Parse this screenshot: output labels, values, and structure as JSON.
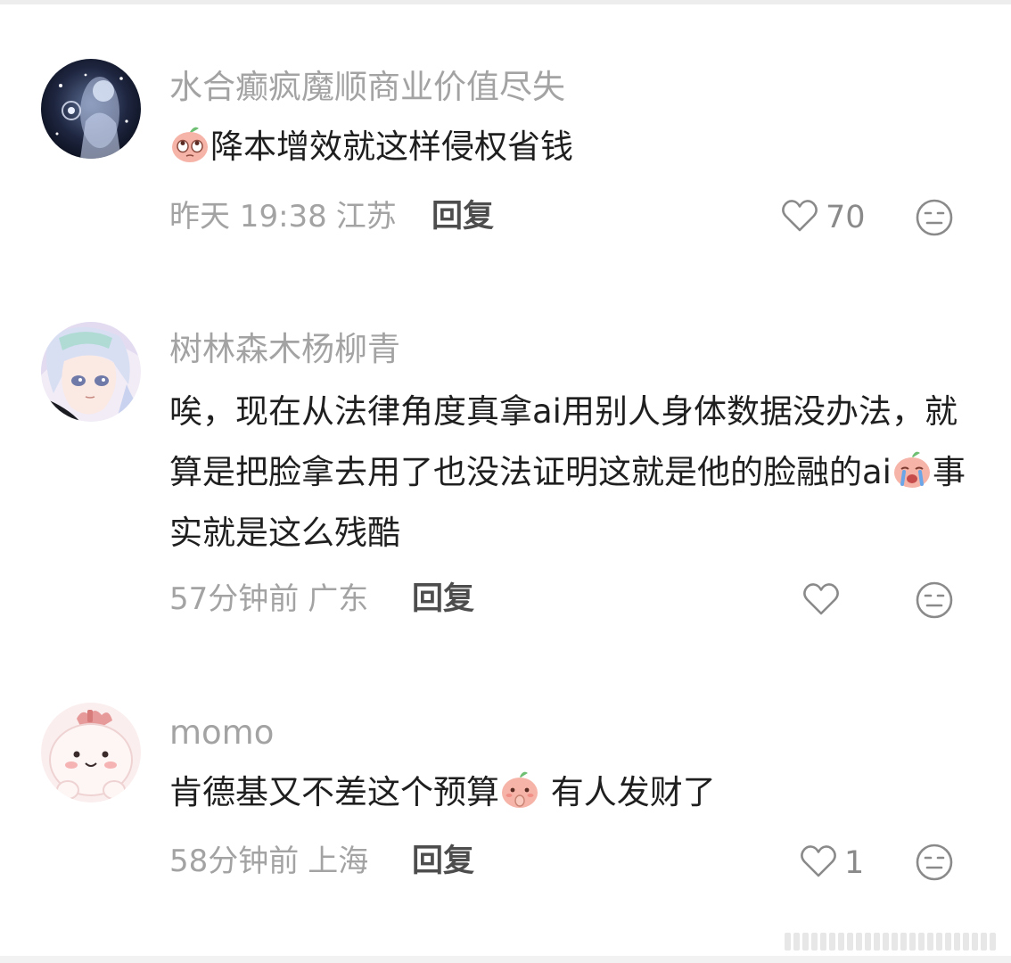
{
  "comments": [
    {
      "username": "水合癫疯魔顺商业价值尽失",
      "text_parts": [
        "降本增效就这样侵权省钱"
      ],
      "emoji": "emoji-rolling-eyes",
      "time": "昨天 19:38",
      "location": "江苏",
      "reply_label": "回复",
      "likes": "70"
    },
    {
      "username": "树林森木杨柳青",
      "text_parts": [
        "唉，现在从法律角度真拿ai用别人身体数据没办法，就算是把脸拿去用了也没法证明这就是他的脸融的ai",
        "事实就是这么残酷"
      ],
      "emoji": "emoji-crying",
      "time": "57分钟前",
      "location": "广东",
      "reply_label": "回复",
      "likes": ""
    },
    {
      "username": "momo",
      "text_parts": [
        "肯德基又不差这个预算",
        " 有人发财了"
      ],
      "emoji": "emoji-finger-in-mouth",
      "time": "58分钟前",
      "location": "上海",
      "reply_label": "回复",
      "likes": "1"
    }
  ],
  "icons": {
    "like": "heart-outline-icon",
    "dislike": "neutral-face-icon"
  },
  "colors": {
    "username": "#a3a3a3",
    "text": "#1f1f1f",
    "meta": "#a3a3a3",
    "reply": "#4d4d4d",
    "emoji_face": "#f6b4a8"
  }
}
